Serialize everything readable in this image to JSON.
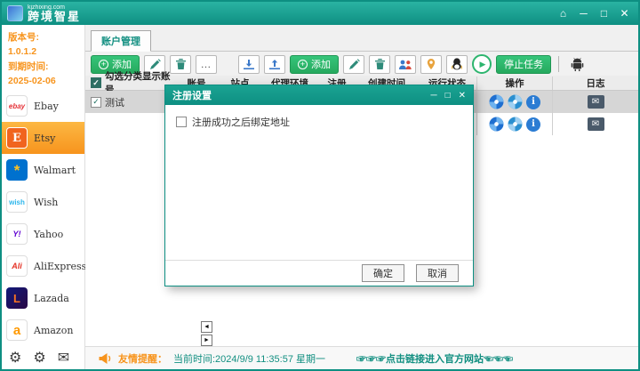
{
  "titlebar": {
    "site": "kjzhixing.com",
    "app_name": "跨境智星"
  },
  "icons": {
    "home": "⌂",
    "minimize": "─",
    "maximize": "□",
    "close": "✕",
    "plus": "+",
    "more": "…",
    "play": "▶",
    "check": "✓",
    "info": "i",
    "mail": "✉",
    "gear": "⚙",
    "left": "◄",
    "right": "►"
  },
  "sidebar": {
    "version_label": "版本号:",
    "version_value": "1.0.1.2",
    "expire_label": "到期时间:",
    "expire_value": "2025-02-06",
    "platforms": [
      {
        "label": "Ebay",
        "abbr": "ebay"
      },
      {
        "label": "Etsy",
        "abbr": "E"
      },
      {
        "label": "Walmart",
        "abbr": "*"
      },
      {
        "label": "Wish",
        "abbr": "wish"
      },
      {
        "label": "Yahoo",
        "abbr": "Y!"
      },
      {
        "label": "AliExpress",
        "abbr": "Ali"
      },
      {
        "label": "Lazada",
        "abbr": "L"
      },
      {
        "label": "Amazon",
        "abbr": "a"
      }
    ]
  },
  "tabs": {
    "account": "账户管理"
  },
  "toolbar": {
    "add1": "添加",
    "add2": "添加",
    "stop_task": "停止任务"
  },
  "table": {
    "select_all_label": "勾选分类显示账号",
    "columns": [
      "账号",
      "站点",
      "代理环境",
      "注册",
      "创建时间",
      "运行状态",
      "操作",
      "日志"
    ],
    "rows": [
      {
        "name": "测试"
      },
      {
        "name": ""
      }
    ]
  },
  "dialog": {
    "title": "注册设置",
    "bind_address_label": "注册成功之后绑定地址",
    "ok": "确定",
    "cancel": "取消"
  },
  "statusbar": {
    "reminder_label": "友情提醒：",
    "current_time": "当前时间:2024/9/9 11:35:57 星期一",
    "link_text": "☞☞☞点击链接进入官方网站☜☜☜"
  },
  "colors": {
    "teal": "#0e8f82",
    "green": "#2db56e",
    "orange": "#f7941d"
  }
}
